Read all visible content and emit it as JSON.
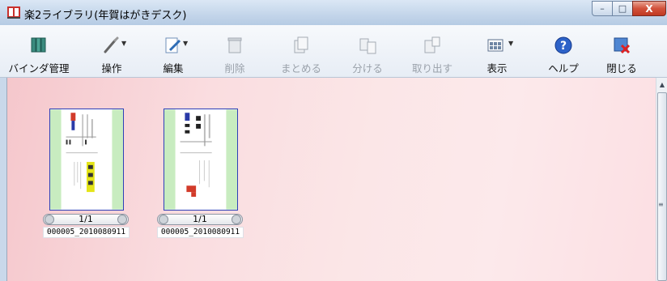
{
  "window": {
    "title": "楽2ライブラリ(年賀はがきデスク)",
    "controls": {
      "minimize": "–",
      "maximize": "□",
      "close": "X"
    }
  },
  "toolbar": {
    "items": [
      {
        "label": "バインダ管理",
        "icon": "binders-icon",
        "enabled": true,
        "dropdown": false
      },
      {
        "label": "操作",
        "icon": "wand-icon",
        "enabled": true,
        "dropdown": true
      },
      {
        "label": "編集",
        "icon": "edit-icon",
        "enabled": true,
        "dropdown": true
      },
      {
        "label": "削除",
        "icon": "trash-icon",
        "enabled": false,
        "dropdown": false
      },
      {
        "label": "まとめる",
        "icon": "combine-icon",
        "enabled": false,
        "dropdown": false
      },
      {
        "label": "分ける",
        "icon": "split-icon",
        "enabled": false,
        "dropdown": false
      },
      {
        "label": "取り出す",
        "icon": "extract-icon",
        "enabled": false,
        "dropdown": false
      },
      {
        "label": "表示",
        "icon": "view-icon",
        "enabled": true,
        "dropdown": true
      },
      {
        "label": "ヘルプ",
        "icon": "help-icon",
        "enabled": true,
        "dropdown": false
      },
      {
        "label": "閉じる",
        "icon": "close-app-icon",
        "enabled": true,
        "dropdown": false
      }
    ]
  },
  "documents": [
    {
      "page_indicator": "1/1",
      "filename": "000005_2010080911"
    },
    {
      "page_indicator": "1/1",
      "filename": "000005_2010080911"
    }
  ],
  "colors": {
    "accent": "#2d3fb8",
    "content_bg": "#fbe3e5",
    "thumb_green": "#c8ecc0"
  }
}
